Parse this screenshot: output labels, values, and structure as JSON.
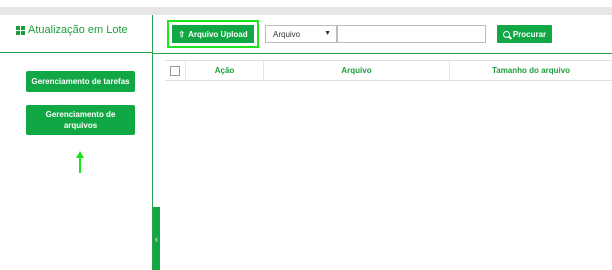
{
  "sidebar": {
    "title": "Atualização em Lote",
    "buttons": {
      "tasks": "Gerenciamento de tarefas",
      "files": "Gerenciamento de arquivos"
    }
  },
  "toolbar": {
    "upload_label": "Arquivo Upload",
    "filter_selected": "Arquivo",
    "search_value": "",
    "search_label": "Procurar"
  },
  "table": {
    "columns": [
      "Ação",
      "Arquivo",
      "Tamanho do arquivo"
    ],
    "rows": []
  },
  "colors": {
    "accent": "#10a744",
    "highlight": "#18e51a"
  }
}
